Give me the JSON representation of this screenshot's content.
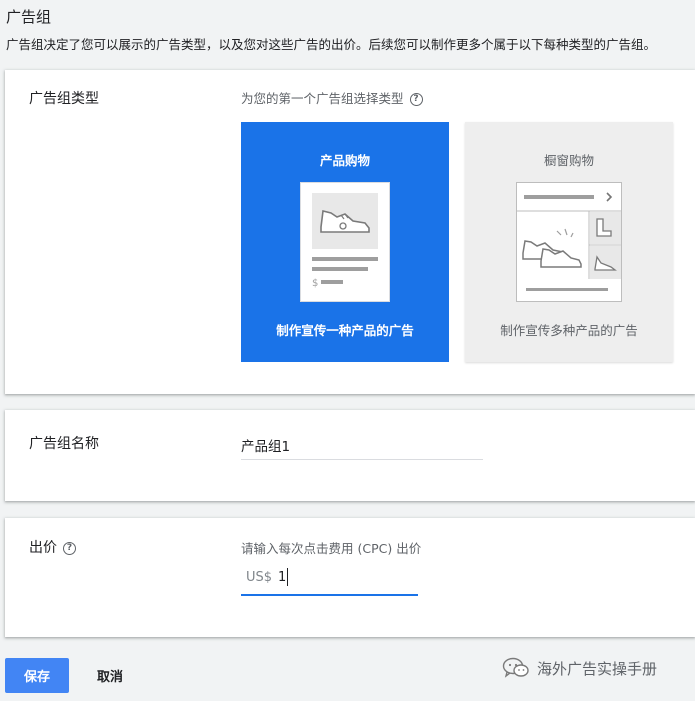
{
  "header": {
    "title": "广告组",
    "description": "广告组决定了您可以展示的广告类型，以及您对这些广告的出价。后续您可以制作更多个属于以下每种类型的广告组。"
  },
  "ad_group_type": {
    "label": "广告组类型",
    "hint": "为您的第一个广告组选择类型",
    "options": [
      {
        "title": "产品购物",
        "caption": "制作宣传一种产品的广告",
        "selected": true,
        "price_symbol": "$"
      },
      {
        "title": "橱窗购物",
        "caption": "制作宣传多种产品的广告",
        "selected": false
      }
    ]
  },
  "ad_group_name": {
    "label": "广告组名称",
    "value": "产品组1"
  },
  "bid": {
    "label": "出价",
    "hint": "请输入每次点击费用 (CPC) 出价",
    "currency_prefix": "US$",
    "value": "1"
  },
  "actions": {
    "save_label": "保存",
    "cancel_label": "取消"
  },
  "watermark": {
    "text": "海外广告实操手册",
    "icon": "wechat-icon"
  },
  "colors": {
    "accent": "#1a73e8",
    "save_button": "#4285f4",
    "background": "#f1f3f4"
  }
}
